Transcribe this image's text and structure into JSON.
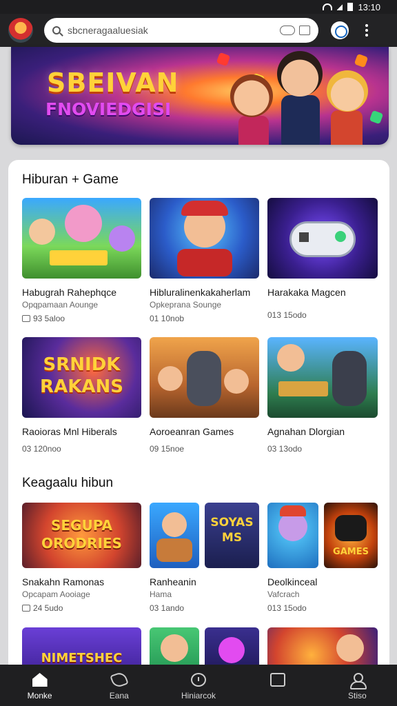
{
  "status_bar": {
    "time": "13:10"
  },
  "search": {
    "value": "sbcneragaaluesiak"
  },
  "hero": {
    "title": "SBEIVAN",
    "subtitle": "FNOVIEDGISI"
  },
  "section1": {
    "title": "Hiburan + Game",
    "items": [
      {
        "name": "Habugrah Rahephqce",
        "category": "Opqpamaan Aounge",
        "meta": "93 5aloo"
      },
      {
        "name": "Hibluralinenkakaherlam",
        "category": "Opkeprana Sounge",
        "meta": "01 10nob"
      },
      {
        "name": "Harakaka Magcen",
        "category": "",
        "meta": "013 15odo"
      },
      {
        "name": "Raoioras Mnl Hiberals",
        "category": "",
        "meta": "03 120noo",
        "thumb_text": "SRNIDK RAKANS"
      },
      {
        "name": "Aoroeanran Games",
        "category": "",
        "meta": "09 15noe"
      },
      {
        "name": "Agnahan Dlorgian",
        "category": "",
        "meta": "03 13odo"
      }
    ]
  },
  "section2": {
    "title": "Keagaalu hibun",
    "items": [
      {
        "name": "Snakahn Ramonas",
        "category": "Opcapam Aooiage",
        "meta": "24 5udo",
        "thumb_text": "SEGUPA ORODRIES"
      },
      {
        "name": "Ranheanin",
        "category": "Hama",
        "meta": "03 1ando",
        "thumb_text": "SOYAS MS"
      },
      {
        "name": "Deolkinceal",
        "category": "Vafcrach",
        "meta": "013 15odo",
        "thumb_text": "GAMES"
      }
    ],
    "partial_thumb_text": "NIMETSHEC"
  },
  "bottom_nav": [
    {
      "label": "Monke",
      "icon": "home-icon"
    },
    {
      "label": "Eana",
      "icon": "gamepad-icon"
    },
    {
      "label": "Hiniarcok",
      "icon": "clock-icon"
    },
    {
      "label": "",
      "icon": "library-icon"
    },
    {
      "label": "Stiso",
      "icon": "profile-icon"
    }
  ]
}
